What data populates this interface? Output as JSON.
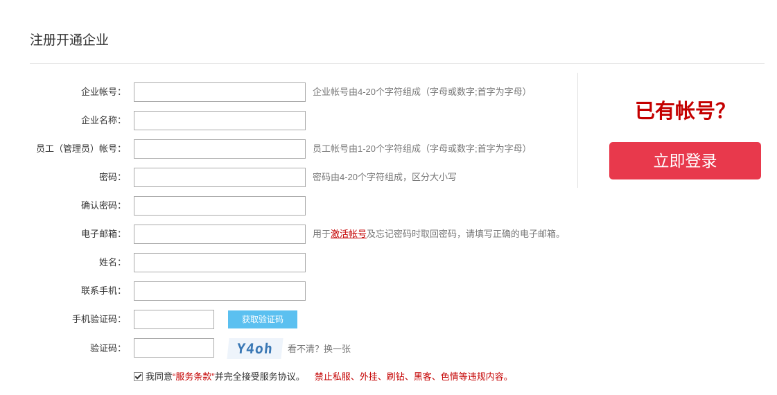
{
  "page": {
    "title": "注册开通企业"
  },
  "form": {
    "fields": [
      {
        "label": "企业帐号：",
        "value": "",
        "hint": "企业帐号由4-20个字符组成（字母或数字;首字为字母）"
      },
      {
        "label": "企业名称：",
        "value": ""
      },
      {
        "label": "员工（管理员）帐号：",
        "value": "",
        "hint": "员工帐号由1-20个字符组成（字母或数字;首字为字母）"
      },
      {
        "label": "密码：",
        "value": "",
        "hint": "密码由4-20个字符组成，区分大小写"
      },
      {
        "label": "确认密码：",
        "value": ""
      },
      {
        "label": "电子邮箱：",
        "value": "",
        "hint_prefix": "用于",
        "hint_link": "激活帐号",
        "hint_suffix": "及忘记密码时取回密码，请填写正确的电子邮箱。"
      },
      {
        "label": "姓名：",
        "value": ""
      },
      {
        "label": "联系手机：",
        "value": ""
      },
      {
        "label": "手机验证码：",
        "value": "",
        "button": "获取验证码"
      },
      {
        "label": "验证码：",
        "value": "",
        "captcha_text": "Y4oh",
        "refresh": "看不清？换一张"
      }
    ],
    "agreement": {
      "checked": true,
      "prefix": "我同意",
      "terms": "“服务条款”",
      "suffix": "并完全接受服务协议。",
      "warning": "禁止私服、外挂、刷钻、黑客、色情等违规内容。"
    }
  },
  "side": {
    "question": "已有帐号？",
    "login_label": "立即登录"
  },
  "colors": {
    "accent_red": "#c40000",
    "login_button": "#e8394c",
    "sms_button": "#5bc0f0"
  }
}
